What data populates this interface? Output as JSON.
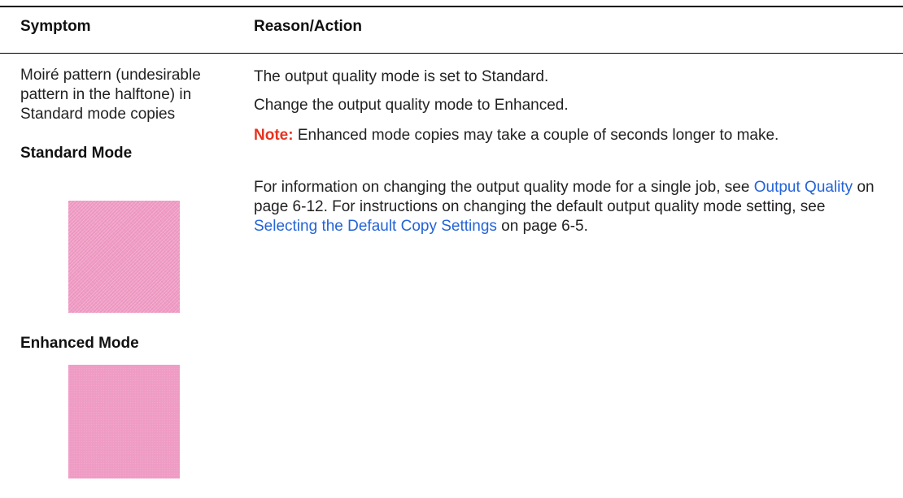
{
  "header": {
    "symptom_label": "Symptom",
    "reason_label": "Reason/Action"
  },
  "row": {
    "symptom": {
      "text": "Moiré pattern (undesirable pattern in the halftone) in Standard mode copies",
      "standard_label": "Standard Mode",
      "enhanced_label": "Enhanced Mode"
    },
    "reason": {
      "line1": "The output quality mode is set to Standard.",
      "line2": "Change the output quality mode to Enhanced.",
      "note_label": "Note:",
      "note_text": " Enhanced mode copies may take a couple of seconds longer to make.",
      "info_prefix": "For information on changing the output quality mode for a single job, see ",
      "link1": "Output Quality",
      "info_mid": " on page 6-12. For instructions on changing the default output quality mode setting, see ",
      "link2": "Selecting the Default Copy Settings",
      "info_suffix": " on page 6-5."
    }
  },
  "colors": {
    "note_red": "#e8321e",
    "link_blue": "#2463d8",
    "swatch_pink": "#ee9ac3"
  }
}
